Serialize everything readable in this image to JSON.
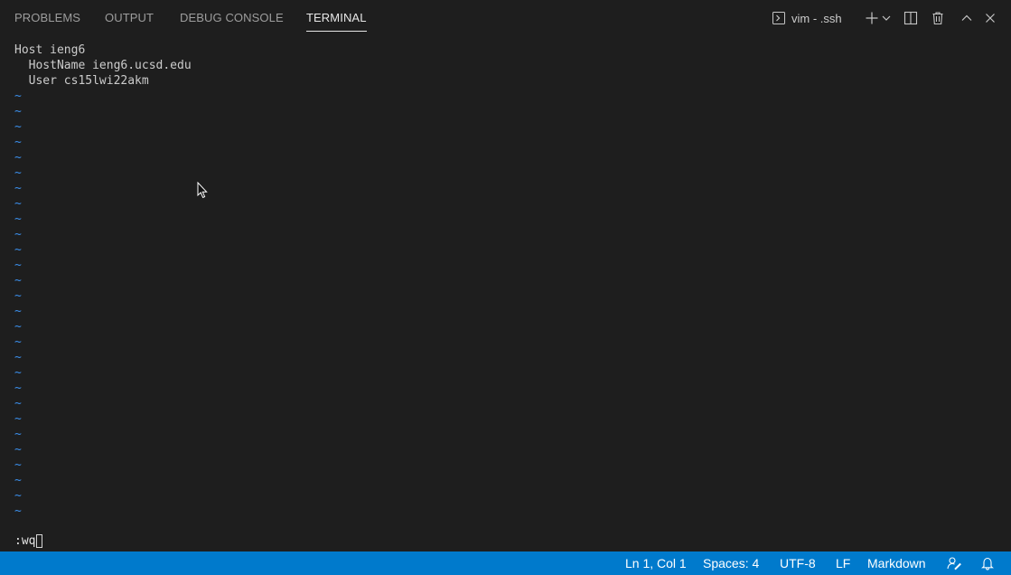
{
  "tabs": [
    {
      "label": "PROBLEMS"
    },
    {
      "label": "OUTPUT"
    },
    {
      "label": "DEBUG CONSOLE"
    },
    {
      "label": "TERMINAL",
      "active": true
    }
  ],
  "actions": {
    "terminal_select_label": "vim - .ssh",
    "terminal_icon": "terminal-icon",
    "add_icon": "plus-icon",
    "dropdown_icon": "chevron-down-icon",
    "split_icon": "split-editor-icon",
    "trash_icon": "trash-icon",
    "maximize_icon": "chevron-up-icon",
    "close_icon": "close-icon"
  },
  "terminal": {
    "lines": [
      "Host ieng6",
      "  HostName ieng6.ucsd.edu",
      "  User cs15lwi22akm"
    ],
    "tilde": "~",
    "command": ":wq"
  },
  "status_bar": {
    "position": "Ln 1, Col 1",
    "spaces": "Spaces: 4",
    "encoding": "UTF-8",
    "eol": "LF",
    "language": "Markdown",
    "feedback_icon": "feedback-icon",
    "bell_icon": "bell-icon"
  },
  "colors": {
    "background": "#1e1e1e",
    "status_bar": "#007acc",
    "tilde": "#3b8eea",
    "text": "#cccccc"
  }
}
